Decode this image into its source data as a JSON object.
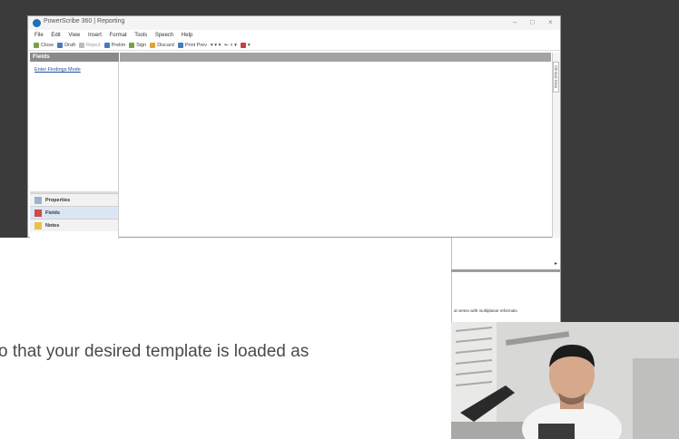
{
  "window": {
    "title": "PowerScribe 360 | Reporting",
    "controls": [
      "–",
      "□",
      "×"
    ]
  },
  "menu": [
    "File",
    "Edit",
    "View",
    "Insert",
    "Format",
    "Tools",
    "Speech",
    "Help"
  ],
  "toolbar": {
    "close": "Close",
    "draft": "Draft",
    "reject": "Reject",
    "prelim": "Prelim",
    "sign": "Sign",
    "discard": "Discard",
    "print": "Print Prev"
  },
  "fields_panel": {
    "header": "Fields",
    "link": "Enter Findings Mode"
  },
  "side_tabs": [
    "Properties",
    "Fields",
    "Notes"
  ],
  "clinical_tab": "Clinical Data",
  "lower_text": "al vertex with multiplanar reformats",
  "caption": "o that your desired template is loaded as",
  "colors": {
    "frame": "#3b3b3b",
    "panel_header": "#8a8a8a",
    "link": "#1e4f9c",
    "active_tab": "#dbe6f5"
  }
}
